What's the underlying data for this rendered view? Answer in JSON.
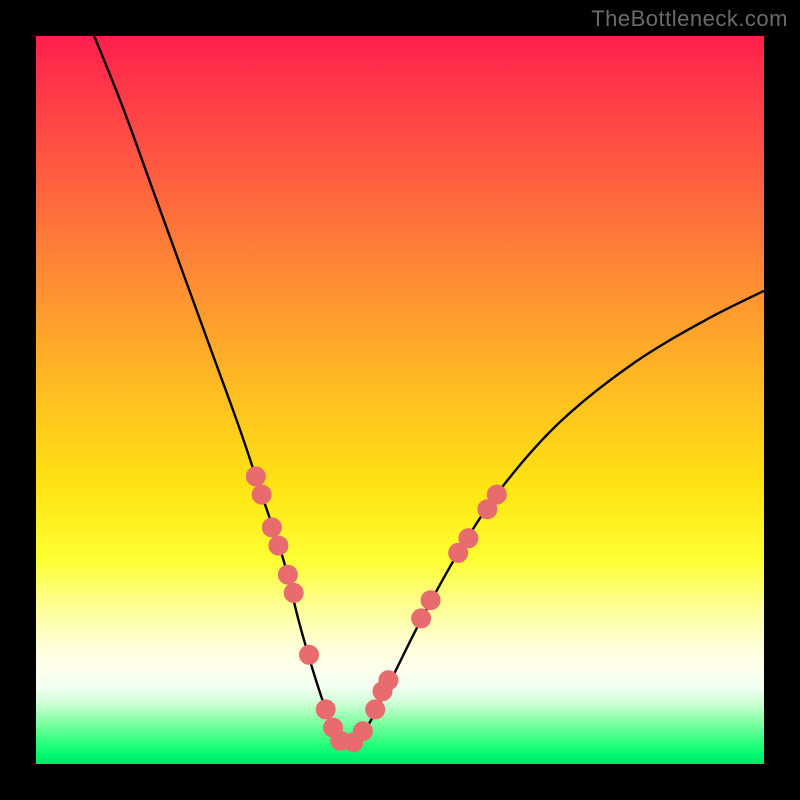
{
  "watermark": "TheBottleneck.com",
  "colors": {
    "dot": "#e86c6e",
    "curve": "#000000",
    "frame": "#000000"
  },
  "chart_data": {
    "type": "line",
    "title": "",
    "xlabel": "",
    "ylabel": "",
    "xlim": [
      0,
      100
    ],
    "ylim": [
      0,
      100
    ],
    "note": "Axes and ticks are not rendered in the image; values are relative percentages of the plot area. Curve depicts a bottleneck/V-shape with minimum near x≈42.",
    "series": [
      {
        "name": "bottleneck-curve",
        "x": [
          8,
          12,
          16,
          20,
          24,
          28,
          31,
          34,
          36,
          38,
          40,
          42,
          44,
          46,
          49,
          53,
          58,
          64,
          72,
          82,
          92,
          100
        ],
        "y": [
          100,
          90,
          79,
          68,
          57,
          46,
          37,
          28,
          20,
          13,
          7,
          3,
          3,
          6,
          12,
          20,
          29,
          38,
          47,
          55,
          61,
          65
        ]
      }
    ],
    "markers": {
      "name": "highlight-dots",
      "comment": "Pink/coral dots overlaid on lower-curve region",
      "points": [
        {
          "x": 30.2,
          "y": 39.5
        },
        {
          "x": 31.0,
          "y": 37.0
        },
        {
          "x": 32.4,
          "y": 32.5
        },
        {
          "x": 33.3,
          "y": 30.0
        },
        {
          "x": 34.6,
          "y": 26.0
        },
        {
          "x": 35.4,
          "y": 23.5
        },
        {
          "x": 37.5,
          "y": 15.0
        },
        {
          "x": 39.8,
          "y": 7.5
        },
        {
          "x": 40.8,
          "y": 5.0
        },
        {
          "x": 41.8,
          "y": 3.2
        },
        {
          "x": 43.6,
          "y": 3.0
        },
        {
          "x": 44.9,
          "y": 4.5
        },
        {
          "x": 46.6,
          "y": 7.5
        },
        {
          "x": 47.6,
          "y": 10.0
        },
        {
          "x": 48.4,
          "y": 11.5
        },
        {
          "x": 52.9,
          "y": 20.0
        },
        {
          "x": 54.2,
          "y": 22.5
        },
        {
          "x": 58.0,
          "y": 29.0
        },
        {
          "x": 59.4,
          "y": 31.0
        },
        {
          "x": 62.0,
          "y": 35.0
        },
        {
          "x": 63.3,
          "y": 37.0
        }
      ]
    }
  }
}
